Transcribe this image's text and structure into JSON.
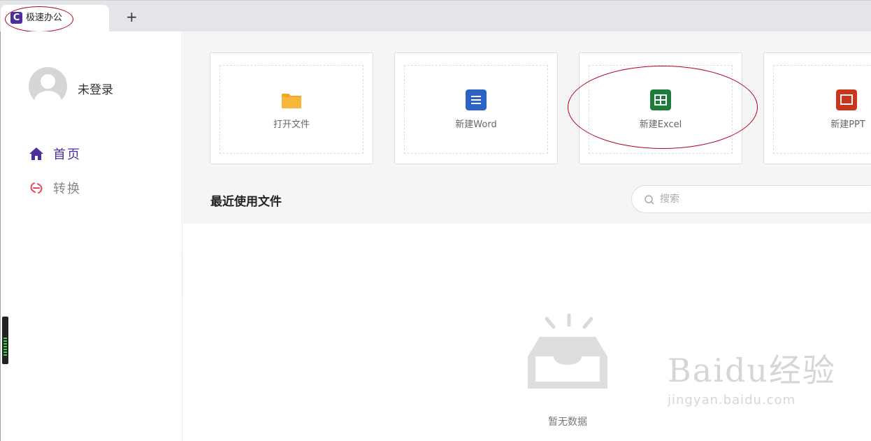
{
  "tab": {
    "title": "极速办公",
    "logo_letter": "C",
    "add": "+"
  },
  "sidebar": {
    "login_status": "未登录",
    "items": [
      {
        "label": "首页",
        "icon": "home-icon",
        "active": true
      },
      {
        "label": "转换",
        "icon": "convert-icon",
        "active": false
      }
    ]
  },
  "cards": [
    {
      "label": "打开文件",
      "icon": "folder-icon",
      "color": "#f5a623"
    },
    {
      "label": "新建Word",
      "icon": "word-icon",
      "color": "#2b62c4"
    },
    {
      "label": "新建Excel",
      "icon": "excel-icon",
      "color": "#1d7c3c"
    },
    {
      "label": "新建PPT",
      "icon": "ppt-icon",
      "color": "#c9361b"
    }
  ],
  "recent": {
    "title": "最近使用文件",
    "search_placeholder": "搜索",
    "empty_text": "暂无数据"
  },
  "watermark": {
    "brand": "Baidu经验",
    "url": "jingyan.baidu.com"
  },
  "colors": {
    "accent": "#4b2fa0",
    "annotation": "#b3001b"
  }
}
